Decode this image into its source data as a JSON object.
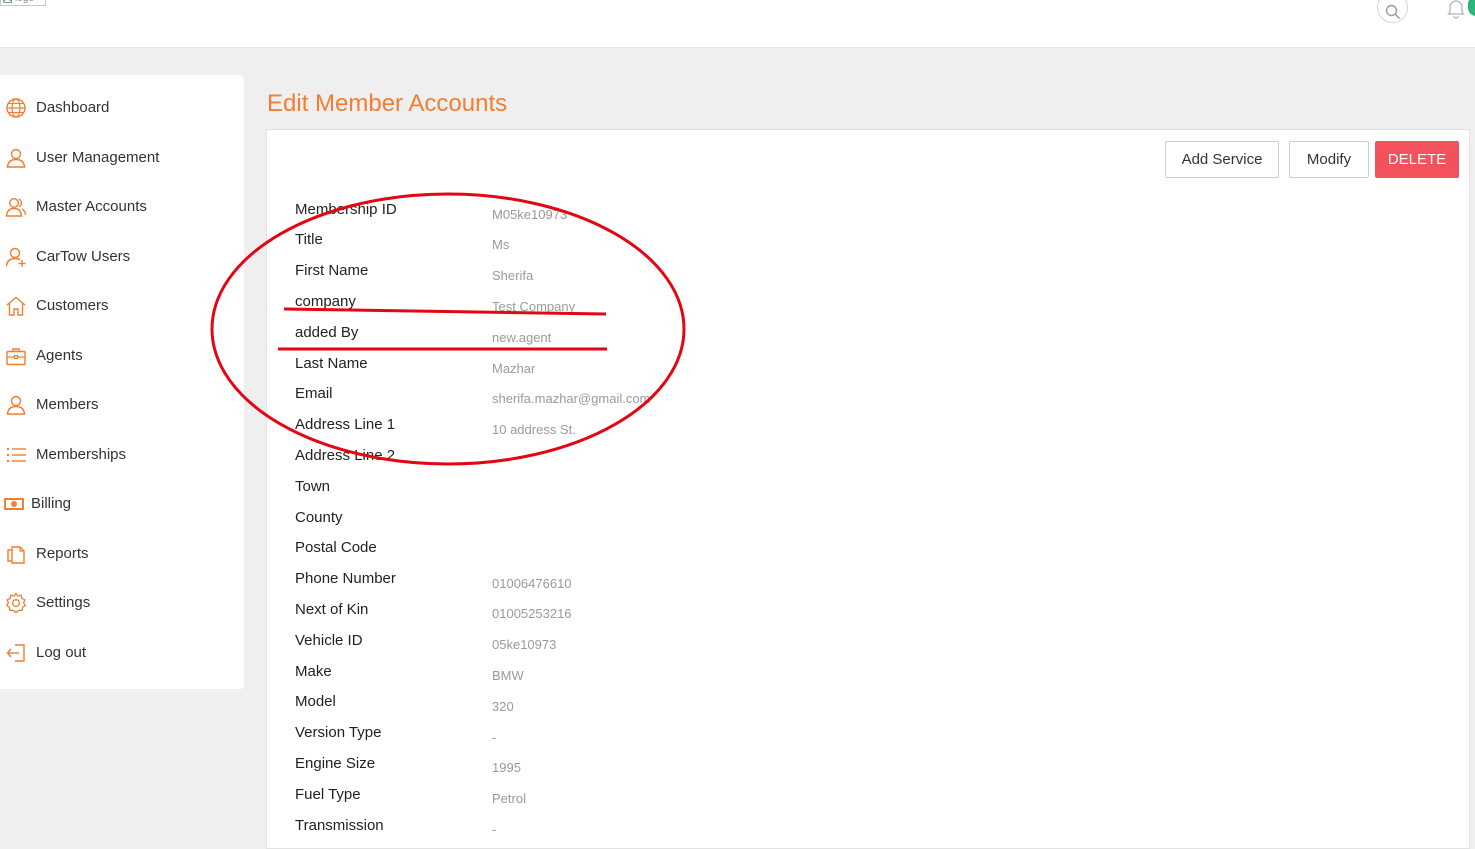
{
  "header": {
    "logo_alt": "logo"
  },
  "colors": {
    "accent": "#f47d30",
    "danger": "#f3525d",
    "annotation": "#e30613"
  },
  "sidebar": {
    "items": [
      {
        "label": "Dashboard",
        "icon": "globe-icon"
      },
      {
        "label": "User Management",
        "icon": "user-icon"
      },
      {
        "label": "Master Accounts",
        "icon": "users-icon"
      },
      {
        "label": "CarTow Users",
        "icon": "user-add-icon"
      },
      {
        "label": "Customers",
        "icon": "home-icon"
      },
      {
        "label": "Agents",
        "icon": "briefcase-icon"
      },
      {
        "label": "Members",
        "icon": "user-icon"
      },
      {
        "label": "Memberships",
        "icon": "list-icon"
      },
      {
        "label": "Billing",
        "icon": "money-icon"
      },
      {
        "label": "Reports",
        "icon": "copy-icon"
      },
      {
        "label": "Settings",
        "icon": "gear-icon"
      },
      {
        "label": "Log out",
        "icon": "logout-icon"
      }
    ]
  },
  "main": {
    "title": "Edit Member Accounts",
    "actions": {
      "add_service": "Add Service",
      "modify": "Modify",
      "delete": "DELETE"
    },
    "fields": [
      {
        "label": "Membership ID",
        "value": "M05ke10973"
      },
      {
        "label": "Title",
        "value": "Ms"
      },
      {
        "label": "First Name",
        "value": "Sherifa"
      },
      {
        "label": "company",
        "value": "Test Company"
      },
      {
        "label": "added By",
        "value": "new.agent"
      },
      {
        "label": "Last Name",
        "value": "Mazhar"
      },
      {
        "label": "Email",
        "value": "sherifa.mazhar@gmail.com"
      },
      {
        "label": "Address Line 1",
        "value": "10 address St."
      },
      {
        "label": "Address Line 2",
        "value": ""
      },
      {
        "label": "Town",
        "value": ""
      },
      {
        "label": "County",
        "value": ""
      },
      {
        "label": "Postal Code",
        "value": ""
      },
      {
        "label": "Phone Number",
        "value": "01006476610"
      },
      {
        "label": "Next of Kin",
        "value": "01005253216"
      },
      {
        "label": "Vehicle ID",
        "value": "05ke10973"
      },
      {
        "label": "Make",
        "value": "BMW"
      },
      {
        "label": "Model",
        "value": "320"
      },
      {
        "label": "Version Type",
        "value": "-"
      },
      {
        "label": "Engine Size",
        "value": "1995"
      },
      {
        "label": "Fuel Type",
        "value": "Petrol"
      },
      {
        "label": "Transmission",
        "value": "-"
      }
    ]
  }
}
